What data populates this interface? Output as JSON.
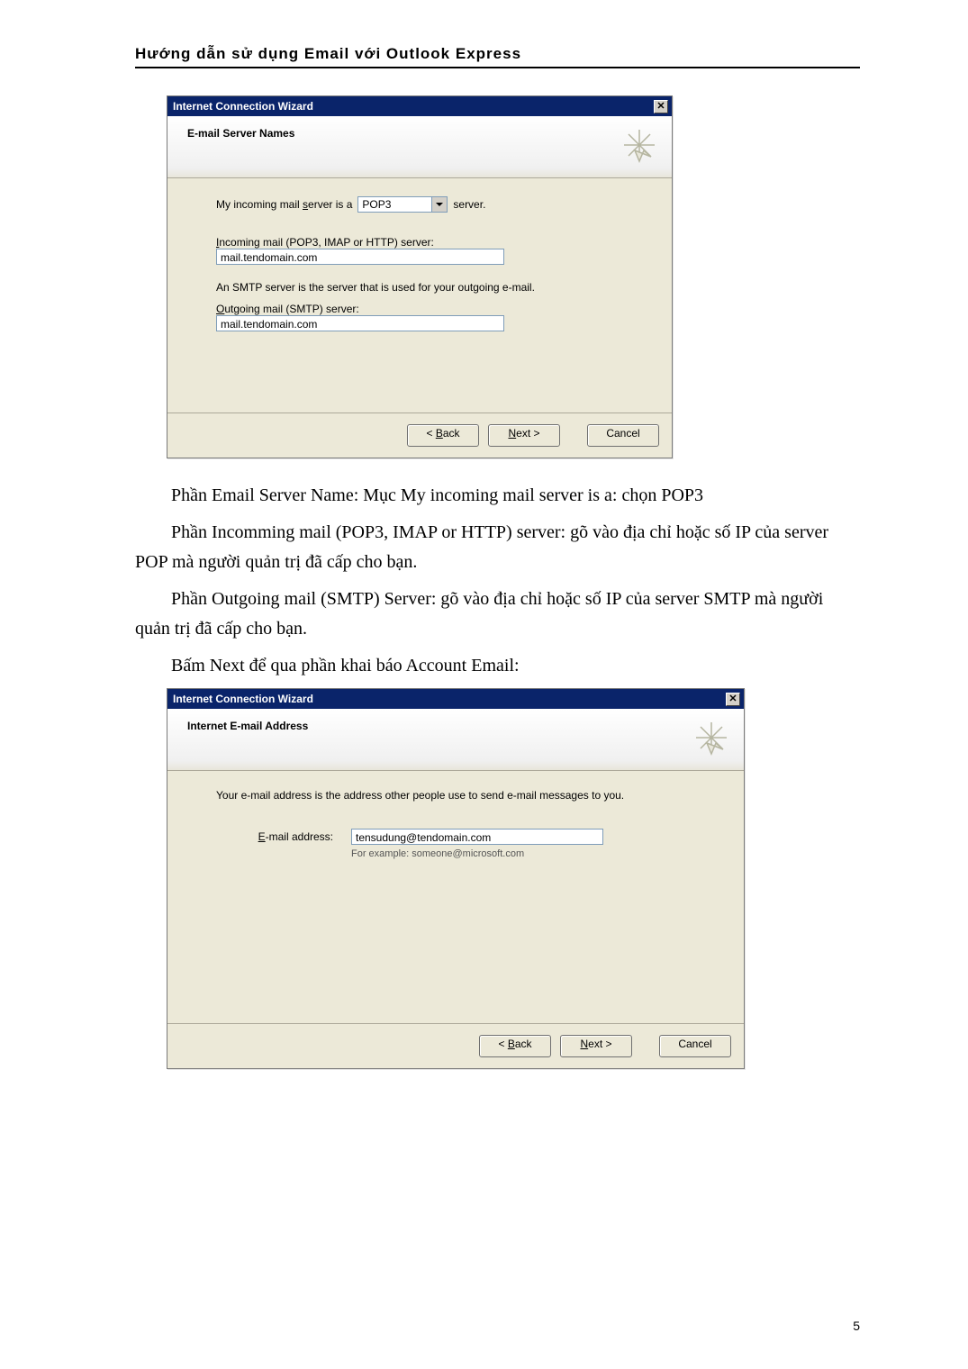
{
  "doc": {
    "header": "Hướng dẫn sử dụng Email với Outlook Express",
    "page_number": "5",
    "para1": "Phần Email Server Name:  Mục My incoming mail server is a:  chọn POP3",
    "para2": "Phần Incomming mail (POP3, IMAP or HTTP) server: gõ vào địa chỉ hoặc số IP của server POP mà người quản trị đã cấp cho bạn.",
    "para3": "Phần Outgoing mail (SMTP) Server: gõ vào địa chỉ hoặc số IP của server SMTP mà người quản trị đã cấp cho bạn.",
    "para4": "Bấm Next để qua phần khai báo Account Email:"
  },
  "dialog1": {
    "title": "Internet Connection Wizard",
    "banner_title": "E-mail Server Names",
    "incoming_prefix": "My incoming mail ",
    "incoming_s": "s",
    "incoming_mid": "erver is a",
    "server_type": "POP3",
    "incoming_suffix": " server.",
    "incoming_i": "I",
    "incoming_label_rest": "ncoming mail (POP3, IMAP or HTTP) server:",
    "incoming_value": "mail.tendomain.com",
    "smtp_note": "An SMTP server is the server that is used for your outgoing e-mail.",
    "outgoing_o": "O",
    "outgoing_label_rest": "utgoing mail (SMTP) server:",
    "outgoing_value": "mail.tendomain.com",
    "back": "< Back",
    "next": "Next >",
    "cancel": "Cancel"
  },
  "dialog2": {
    "title": "Internet Connection Wizard",
    "banner_title": "Internet E-mail Address",
    "intro": "Your e-mail address is the address other people use to send e-mail messages to you.",
    "email_e": "E",
    "email_label_rest": "-mail address:",
    "email_value": "tensudung@tendomain.com",
    "email_hint": "For example: someone@microsoft.com",
    "back": "< Back",
    "next": "Next >",
    "cancel": "Cancel"
  }
}
